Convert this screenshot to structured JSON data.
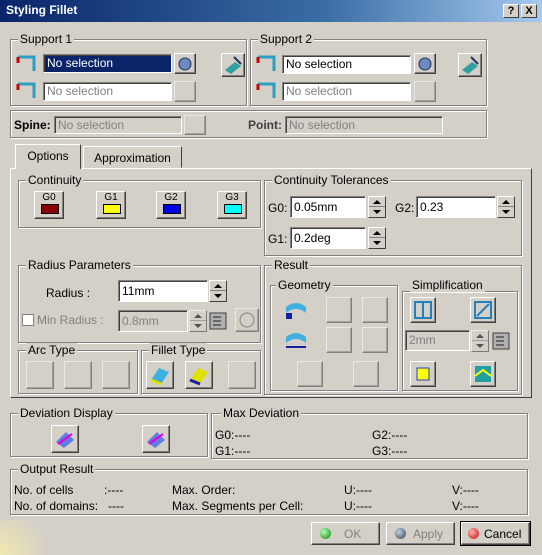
{
  "window": {
    "title": "Styling Fillet",
    "help": "?",
    "close": "X"
  },
  "support1": {
    "label": "Support 1",
    "field1": "No selection",
    "field2": "No selection"
  },
  "support2": {
    "label": "Support 2",
    "field1": "No selection",
    "field2": "No selection"
  },
  "spine": {
    "label": "Spine:",
    "value": "No selection"
  },
  "point": {
    "label": "Point:",
    "value": "No selection"
  },
  "tabs": {
    "options": "Options",
    "approximation": "Approximation"
  },
  "continuity": {
    "label": "Continuity",
    "g0": "G0",
    "g1": "G1",
    "g2": "G2",
    "g3": "G3",
    "colors": {
      "g0": "#8b0000",
      "g1": "#ffff00",
      "g2": "#0000e0",
      "g3": "#00ffff"
    }
  },
  "tolerances": {
    "label": "Continuity Tolerances",
    "g0_label": "G0:",
    "g0_value": "0.05mm",
    "g2_label": "G2:",
    "g2_value": "0.23",
    "g1_label": "G1:",
    "g1_value": "0.2deg"
  },
  "radius": {
    "label": "Radius Parameters",
    "radius_label": "Radius :",
    "radius_value": "11mm",
    "min_label": "Min Radius :",
    "min_value": "0.8mm"
  },
  "result": {
    "label": "Result",
    "geometry": "Geometry",
    "simplification": "Simplification",
    "simp_value": "2mm"
  },
  "arc_type": {
    "label": "Arc Type"
  },
  "fillet_type": {
    "label": "Fillet Type"
  },
  "deviation_display": {
    "label": "Deviation Display"
  },
  "max_deviation": {
    "label": "Max Deviation",
    "g0": "G0:----",
    "g2": "G2:----",
    "g1": "G1:----",
    "g3": "G3:----"
  },
  "output": {
    "label": "Output Result",
    "cells": "No. of cells",
    "cells_val": ":----",
    "domains": "No. of domains:",
    "domains_val": "----",
    "max_order": "Max. Order:",
    "max_segments": "Max. Segments per Cell:",
    "u1": "U:----",
    "v1": "V:----",
    "u2": "U:----",
    "v2": "V:----"
  },
  "buttons": {
    "ok": "OK",
    "apply": "Apply",
    "cancel": "Cancel"
  }
}
